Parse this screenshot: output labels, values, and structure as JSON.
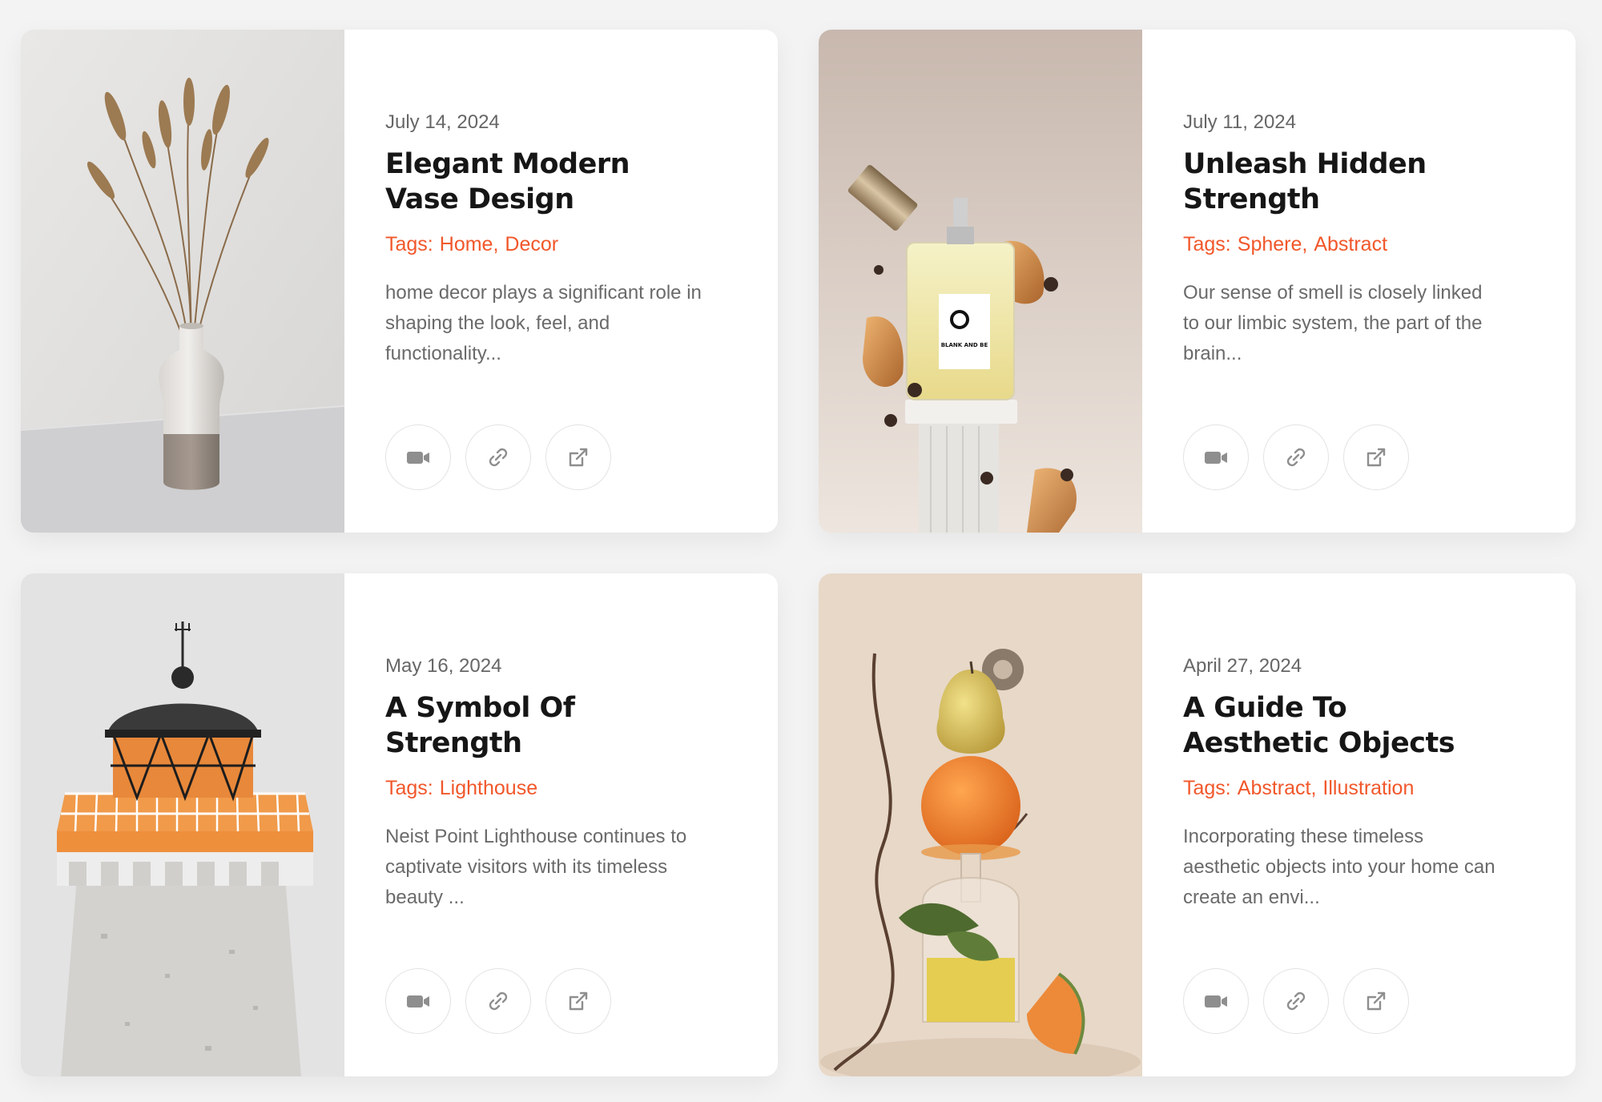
{
  "posts": [
    {
      "date": "July 14, 2024",
      "title_line1": "Elegant Modern",
      "title_line2": "Vase Design",
      "tags_label": "Tags:",
      "tags": [
        "Home,",
        "Decor"
      ],
      "excerpt": "home decor plays a significant role in shaping the look, feel, and functionality...",
      "image": "vase-photo"
    },
    {
      "date": "July 11, 2024",
      "title_line1": "Unleash Hidden",
      "title_line2": "Strength",
      "tags_label": "Tags:",
      "tags": [
        "Sphere,",
        "Abstract"
      ],
      "excerpt": "Our sense of smell is closely linked to our limbic system, the part of the brain...",
      "image": "perfume-photo",
      "image_label": "BLANK AND BE"
    },
    {
      "date": "May 16, 2024",
      "title_line1": "A Symbol Of",
      "title_line2": "Strength",
      "tags_label": "Tags:",
      "tags": [
        "Lighthouse"
      ],
      "excerpt": "Neist Point Lighthouse continues to captivate visitors with its timeless beauty ...",
      "image": "lighthouse-photo"
    },
    {
      "date": "April 27, 2024",
      "title_line1": "A Guide To",
      "title_line2": "Aesthetic Objects",
      "tags_label": "Tags:",
      "tags": [
        "Abstract,",
        "Illustration"
      ],
      "excerpt": "Incorporating these timeless aesthetic objects into your home can create an envi...",
      "image": "fruit-stack-photo"
    }
  ],
  "actions": {
    "video_icon": "video-camera-icon",
    "link_icon": "link-icon",
    "external_icon": "external-link-icon"
  },
  "colors": {
    "accent": "#f1572a",
    "title": "#161616",
    "muted": "#6a6a6a",
    "background": "#f3f3f3"
  }
}
